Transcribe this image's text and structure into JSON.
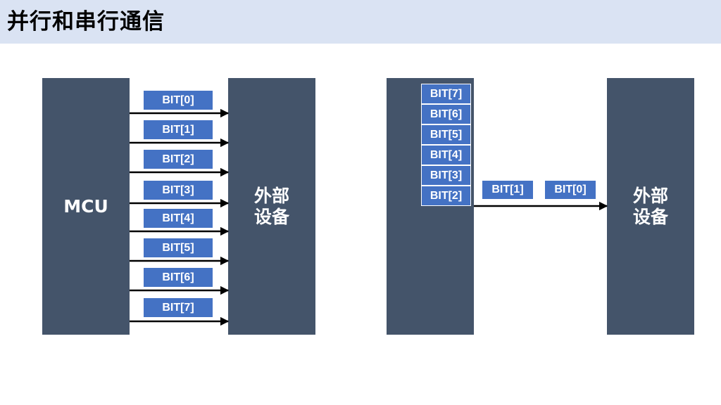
{
  "title": "并行和串行通信",
  "parallel": {
    "source_label": "MCU",
    "target_label": "外部\n设备",
    "bits": [
      "BIT[0]",
      "BIT[1]",
      "BIT[2]",
      "BIT[3]",
      "BIT[4]",
      "BIT[5]",
      "BIT[6]",
      "BIT[7]"
    ]
  },
  "serial": {
    "target_label": "外部\n设备",
    "stack_bits": [
      "BIT[7]",
      "BIT[6]",
      "BIT[5]",
      "BIT[4]",
      "BIT[3]",
      "BIT[2]"
    ],
    "transit_bits": [
      "BIT[1]",
      "BIT[0]"
    ]
  },
  "colors": {
    "block": "#44546a",
    "bit": "#4472c4",
    "title_bar": "#dae3f3",
    "arrow": "#000000"
  }
}
